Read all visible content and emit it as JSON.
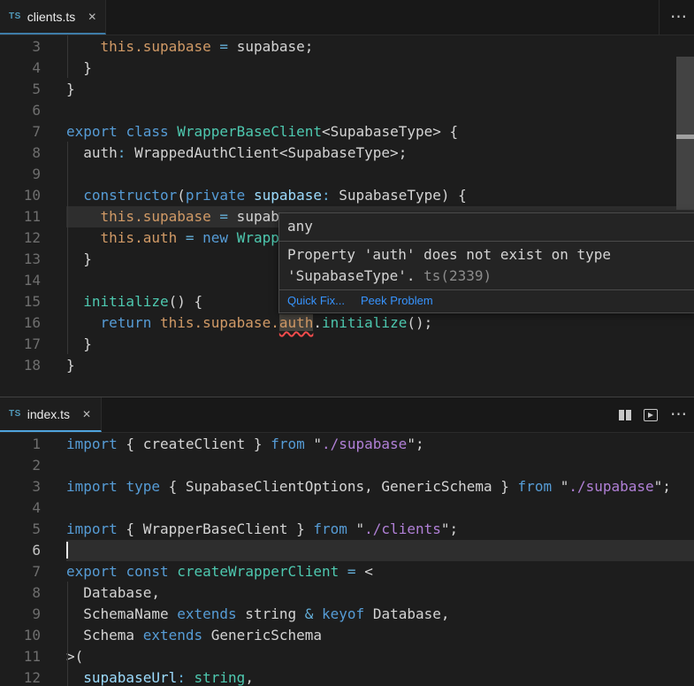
{
  "palette": {
    "editor_bg": "#1D1D1D",
    "tabbar_bg": "#181818",
    "tab_active_bg": "#1E1E1E",
    "tab_border_blue_focused": "#4FA3DD",
    "tab_border_blue_unfocused": "#3E7CA8",
    "keyword": "#569CD6",
    "operator": "#64AED8",
    "teal": "#4EC9B0",
    "orange": "#D19A66",
    "param": "#9CDCFE",
    "text": "#D4D4D4",
    "string": "#B180D7",
    "line_number": "#6E6E6E",
    "line_number_active": "#C2C2C2",
    "current_line": "#2E2E2E",
    "hover_bg": "#242424",
    "hover_border": "#4A4A4A",
    "link": "#3794FF",
    "error": "#F14C4C",
    "ts_icon": "#519ABA",
    "scrollbar": "#434343",
    "scrollbar_deco": "#A0A0A0",
    "indent_guide": "#363636",
    "word_highlight_bg": "#45423C"
  },
  "panes": [
    {
      "tab": {
        "icon_text": "TS",
        "label": "clients.ts",
        "close_glyph": "✕"
      },
      "actions": {
        "more_glyph": "⋯"
      },
      "lines": [
        {
          "n": 3,
          "tokens": [
            [
              "    ",
              "tx"
            ],
            [
              "this.supabase",
              "or"
            ],
            [
              " ",
              "tx"
            ],
            [
              "=",
              "op"
            ],
            [
              " ",
              "tx"
            ],
            [
              "supabase;",
              "tx"
            ]
          ]
        },
        {
          "n": 4,
          "tokens": [
            [
              "  }",
              "tx"
            ]
          ]
        },
        {
          "n": 5,
          "tokens": [
            [
              "}",
              "tx"
            ]
          ]
        },
        {
          "n": 6,
          "tokens": []
        },
        {
          "n": 7,
          "tokens": [
            [
              "export",
              "kw"
            ],
            [
              " ",
              "tx"
            ],
            [
              "class",
              "kw"
            ],
            [
              " ",
              "tx"
            ],
            [
              "WrapperBaseClient",
              "tl"
            ],
            [
              "<SupabaseType> {",
              "tx"
            ]
          ]
        },
        {
          "n": 8,
          "tokens": [
            [
              "  auth",
              "tx"
            ],
            [
              ":",
              "op"
            ],
            [
              " WrappedAuthClient<SupabaseType>;",
              "tx"
            ]
          ]
        },
        {
          "n": 9,
          "tokens": []
        },
        {
          "n": 10,
          "tokens": [
            [
              "  ",
              "tx"
            ],
            [
              "constructor",
              "kw"
            ],
            [
              "(",
              "tx"
            ],
            [
              "private",
              "kw"
            ],
            [
              " ",
              "tx"
            ],
            [
              "supabase",
              "pm"
            ],
            [
              ":",
              "op"
            ],
            [
              " SupabaseType) {",
              "tx"
            ]
          ]
        },
        {
          "n": 11,
          "current": true,
          "tokens": [
            [
              "    ",
              "tx"
            ],
            [
              "this.supabase",
              "or"
            ],
            [
              " ",
              "tx"
            ],
            [
              "=",
              "op"
            ],
            [
              " supab",
              "tx"
            ]
          ]
        },
        {
          "n": 12,
          "tokens": [
            [
              "    ",
              "tx"
            ],
            [
              "this.auth",
              "or"
            ],
            [
              " ",
              "tx"
            ],
            [
              "=",
              "op"
            ],
            [
              " ",
              "tx"
            ],
            [
              "new",
              "kw"
            ],
            [
              " ",
              "tx"
            ],
            [
              "Wrapp",
              "tl"
            ]
          ]
        },
        {
          "n": 13,
          "tokens": [
            [
              "  }",
              "tx"
            ]
          ]
        },
        {
          "n": 14,
          "tokens": []
        },
        {
          "n": 15,
          "tokens": [
            [
              "  ",
              "tx"
            ],
            [
              "initialize",
              "tl"
            ],
            [
              "() {",
              "tx"
            ]
          ]
        },
        {
          "n": 16,
          "tokens": [
            [
              "    ",
              "tx"
            ],
            [
              "return",
              "kw"
            ],
            [
              " ",
              "tx"
            ],
            [
              "this.supabase.",
              "or"
            ],
            [
              "auth",
              "or",
              "err"
            ],
            [
              ".",
              "tx"
            ],
            [
              "initialize",
              "tl"
            ],
            [
              "();",
              "tx"
            ]
          ]
        },
        {
          "n": 17,
          "tokens": [
            [
              "  }",
              "tx"
            ]
          ]
        },
        {
          "n": 18,
          "tokens": [
            [
              "}",
              "tx"
            ]
          ]
        }
      ]
    },
    {
      "tab": {
        "icon_text": "TS",
        "label": "index.ts",
        "close_glyph": "✕"
      },
      "actions": {
        "more_glyph": "⋯"
      },
      "lines": [
        {
          "n": 1,
          "tokens": [
            [
              "import",
              "kw"
            ],
            [
              " { createClient } ",
              "tx"
            ],
            [
              "from",
              "kw"
            ],
            [
              " \"",
              "tx"
            ],
            [
              "./supabase",
              "st"
            ],
            [
              "\";",
              "tx"
            ]
          ]
        },
        {
          "n": 2,
          "tokens": []
        },
        {
          "n": 3,
          "tokens": [
            [
              "import",
              "kw"
            ],
            [
              " ",
              "tx"
            ],
            [
              "type",
              "kw"
            ],
            [
              " { SupabaseClientOptions, GenericSchema } ",
              "tx"
            ],
            [
              "from",
              "kw"
            ],
            [
              " \"",
              "tx"
            ],
            [
              "./supabase",
              "st"
            ],
            [
              "\";",
              "tx"
            ]
          ]
        },
        {
          "n": 4,
          "tokens": []
        },
        {
          "n": 5,
          "tokens": [
            [
              "import",
              "kw"
            ],
            [
              " { WrapperBaseClient } ",
              "tx"
            ],
            [
              "from",
              "kw"
            ],
            [
              " \"",
              "tx"
            ],
            [
              "./clients",
              "st"
            ],
            [
              "\";",
              "tx"
            ]
          ]
        },
        {
          "n": 6,
          "current": true,
          "cursor": true,
          "tokens": []
        },
        {
          "n": 7,
          "tokens": [
            [
              "export",
              "kw"
            ],
            [
              " ",
              "tx"
            ],
            [
              "const",
              "kw"
            ],
            [
              " ",
              "tx"
            ],
            [
              "createWrapperClient",
              "tl"
            ],
            [
              " ",
              "tx"
            ],
            [
              "=",
              "op"
            ],
            [
              " <",
              "tx"
            ]
          ]
        },
        {
          "n": 8,
          "tokens": [
            [
              "  Database,",
              "tx"
            ]
          ]
        },
        {
          "n": 9,
          "tokens": [
            [
              "  SchemaName ",
              "tx"
            ],
            [
              "extends",
              "kw"
            ],
            [
              " string ",
              "tx"
            ],
            [
              "&",
              "op"
            ],
            [
              " ",
              "tx"
            ],
            [
              "keyof",
              "kw"
            ],
            [
              " Database,",
              "tx"
            ]
          ]
        },
        {
          "n": 10,
          "tokens": [
            [
              "  Schema ",
              "tx"
            ],
            [
              "extends",
              "kw"
            ],
            [
              " GenericSchema",
              "tx"
            ]
          ]
        },
        {
          "n": 11,
          "tokens": [
            [
              ">(",
              "tx"
            ]
          ]
        },
        {
          "n": 12,
          "tokens": [
            [
              "  ",
              "tx"
            ],
            [
              "supabaseUrl",
              "pm"
            ],
            [
              ":",
              "op"
            ],
            [
              " ",
              "tx"
            ],
            [
              "string",
              "tl"
            ],
            [
              ",",
              "tx"
            ]
          ]
        }
      ]
    }
  ],
  "hover": {
    "type_text": "any",
    "message": "Property 'auth' does not exist on type 'SupabaseType'. ",
    "code": "ts(2339)",
    "quick_fix_label": "Quick Fix...",
    "peek_problem_label": "Peek Problem"
  }
}
